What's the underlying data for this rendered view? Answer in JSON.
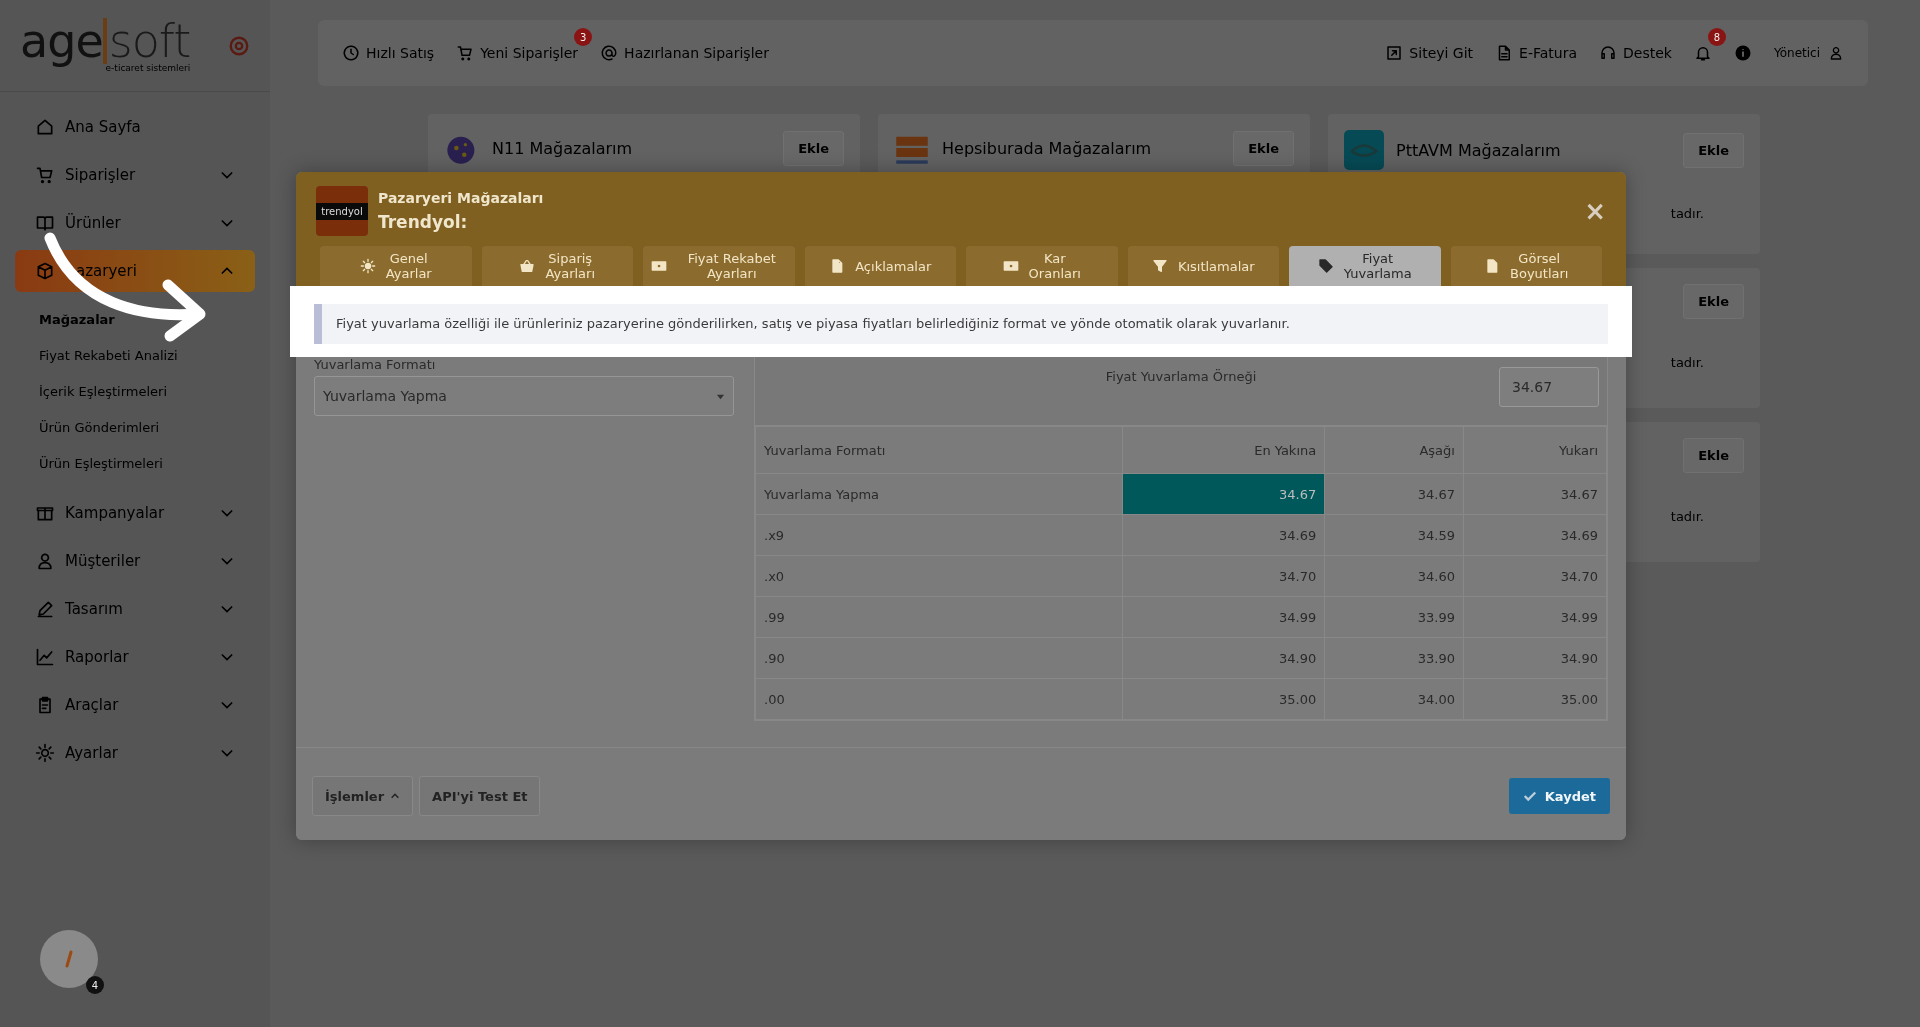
{
  "logo": {
    "main": "age",
    "accent": "soft",
    "tagline": "e-ticaret sistemleri"
  },
  "sidebar": {
    "items": [
      {
        "label": "Ana Sayfa",
        "kind": "link",
        "selected": false
      },
      {
        "label": "Siparişler",
        "kind": "group",
        "selected": false,
        "expanded": false
      },
      {
        "label": "Ürünler",
        "kind": "group",
        "selected": false,
        "expanded": false
      },
      {
        "label": "azaryeri",
        "kind": "group",
        "selected": true,
        "expanded": true,
        "children": [
          {
            "label": "Mağazalar",
            "selected": true
          },
          {
            "label": "Fiyat Rekabeti Analizi",
            "selected": false
          },
          {
            "label": "İçerik Eşleştirmeleri",
            "selected": false
          },
          {
            "label": "Ürün Gönderimleri",
            "selected": false
          },
          {
            "label": "Ürün Eşleştirmeleri",
            "selected": false
          }
        ]
      },
      {
        "label": "Kampanyalar",
        "kind": "group",
        "selected": false,
        "expanded": false
      },
      {
        "label": "Müşteriler",
        "kind": "group",
        "selected": false,
        "expanded": false
      },
      {
        "label": "Tasarım",
        "kind": "group",
        "selected": false,
        "expanded": false
      },
      {
        "label": "Raporlar",
        "kind": "group",
        "selected": false,
        "expanded": false
      },
      {
        "label": "Araçlar",
        "kind": "group",
        "selected": false,
        "expanded": false
      },
      {
        "label": "Ayarlar",
        "kind": "group",
        "selected": false,
        "expanded": false
      }
    ]
  },
  "topbar": {
    "left": [
      {
        "label": "Hızlı Satış"
      },
      {
        "label": "Yeni Siparişler",
        "badge": "3"
      },
      {
        "label": "Hazırlanan Siparişler"
      }
    ],
    "right": [
      {
        "label": "Siteyi Git"
      },
      {
        "label": "E-Fatura"
      },
      {
        "label": "Destek"
      }
    ],
    "notifications": {
      "badge": "8"
    },
    "user": "Yönetici"
  },
  "stores": [
    {
      "name": "N11 Mağazalarım",
      "button": "Ekle"
    },
    {
      "name": "Hepsiburada Mağazalarım",
      "button": "Ekle"
    },
    {
      "name": "PttAVM Mağazalarım",
      "button": "Ekle",
      "cards": [
        {
          "note": "tadır."
        },
        {
          "button": "Ekle",
          "note": "tadır."
        },
        {
          "button": "Ekle",
          "note": "tadır."
        }
      ]
    }
  ],
  "modal": {
    "logo_text": "trendyol",
    "title": "Pazaryeri Mağazaları",
    "subtitle": "Trendyol:",
    "close": "×",
    "tabs": [
      {
        "label": "Genel Ayarlar",
        "selected": false
      },
      {
        "label": "Sipariş Ayarları",
        "selected": false
      },
      {
        "label": "Fiyat Rekabet Ayarları",
        "selected": false
      },
      {
        "label": "Açıklamalar",
        "selected": false
      },
      {
        "label": "Kar Oranları",
        "selected": false
      },
      {
        "label": "Kısıtlamalar",
        "selected": false
      },
      {
        "label": "Fiyat Yuvarlama",
        "selected": true
      },
      {
        "label": "Görsel Boyutları",
        "selected": false
      }
    ],
    "info": "Fiyat yuvarlama özelliği ile ürünleriniz pazaryerine gönderilirken, satış ve piyasa fiyatları belirlediğiniz format ve yönde otomatik olarak yuvarlanır.",
    "format_label": "Yuvarlama Formatı",
    "format_value": "Yuvarlama Yapma",
    "example_title": "Fiyat Yuvarlama Örneği",
    "example_value": "34.67",
    "columns": [
      "Yuvarlama Formatı",
      "En Yakına",
      "Aşağı",
      "Yukarı"
    ],
    "rows": [
      {
        "format": "Yuvarlama Yapma",
        "nearest": "34.67",
        "down": "34.67",
        "up": "34.67",
        "selected": true
      },
      {
        "format": ".x9",
        "nearest": "34.69",
        "down": "34.59",
        "up": "34.69",
        "selected": false
      },
      {
        "format": ".x0",
        "nearest": "34.70",
        "down": "34.60",
        "up": "34.70",
        "selected": false
      },
      {
        "format": ".99",
        "nearest": "34.99",
        "down": "33.99",
        "up": "34.99",
        "selected": false
      },
      {
        "format": ".90",
        "nearest": "34.90",
        "down": "33.90",
        "up": "34.90",
        "selected": false
      },
      {
        "format": ".00",
        "nearest": "35.00",
        "down": "34.00",
        "up": "35.00",
        "selected": false
      }
    ],
    "footer_buttons": [
      "İşlemler",
      "API'yi Test Et"
    ],
    "save": "Kaydet"
  },
  "widget": {
    "badge": "4"
  }
}
